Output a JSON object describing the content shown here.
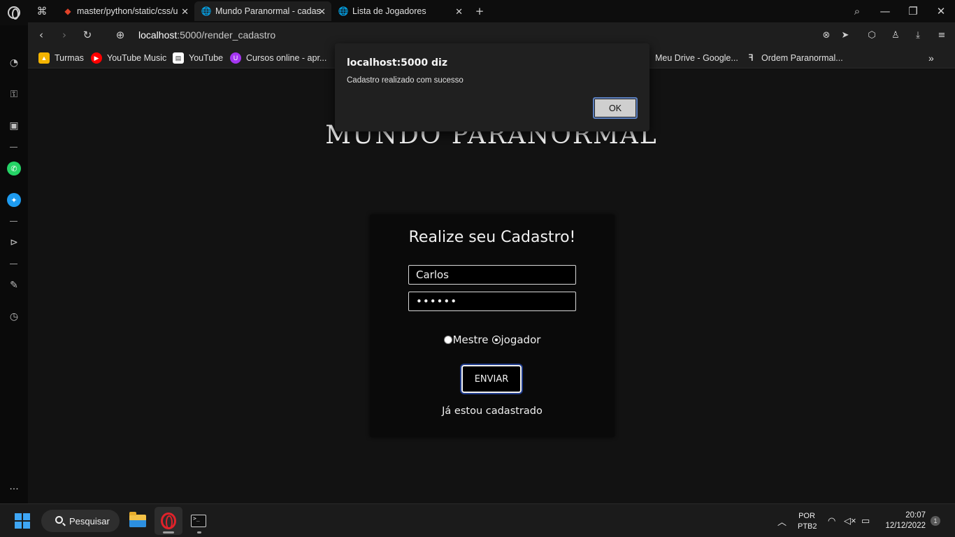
{
  "browser": {
    "tabs": [
      {
        "title": "master/python/static/css/u",
        "icon": "gitlab-icon"
      },
      {
        "title": "Mundo Paranormal - cadas",
        "icon": "globe-icon",
        "active": true
      },
      {
        "title": "Lista de Jogadores",
        "icon": "globe-icon"
      }
    ],
    "address": {
      "host": "localhost",
      "path": ":5000/render_cadastro"
    },
    "bookmarks": [
      {
        "label": "Turmas",
        "icon": "classroom-icon",
        "color": "#f4b400"
      },
      {
        "label": "YouTube Music",
        "icon": "youtube-music-icon",
        "color": "#ff0000"
      },
      {
        "label": "YouTube",
        "icon": "document-icon",
        "color": "#ffffff"
      },
      {
        "label": "Cursos online - apr...",
        "icon": "udemy-icon",
        "color": "#a435f0"
      },
      {
        "label": "Meu Drive - Google...",
        "icon": "drive-icon",
        "color": "#1fa463"
      },
      {
        "label": "Ordem Paranormal...",
        "icon": "figure-icon",
        "color": "#ffffff"
      }
    ]
  },
  "dialog": {
    "title": "localhost:5000 diz",
    "message": "Cadastro realizado com sucesso",
    "ok_label": "OK"
  },
  "page": {
    "site_title": "MUNDO PARANORMAL",
    "form": {
      "heading": "Realize seu Cadastro!",
      "name_value": "Carlos",
      "password_value": "••••••",
      "role_options": [
        "Mestre",
        "jogador"
      ],
      "selected_role": "jogador",
      "submit_label": "ENVIAR",
      "login_link": "Já estou cadastrado"
    }
  },
  "taskbar": {
    "search_label": "Pesquisar",
    "language": [
      "POR",
      "PTB2"
    ],
    "time": "20:07",
    "date": "12/12/2022",
    "notification_count": "1"
  }
}
